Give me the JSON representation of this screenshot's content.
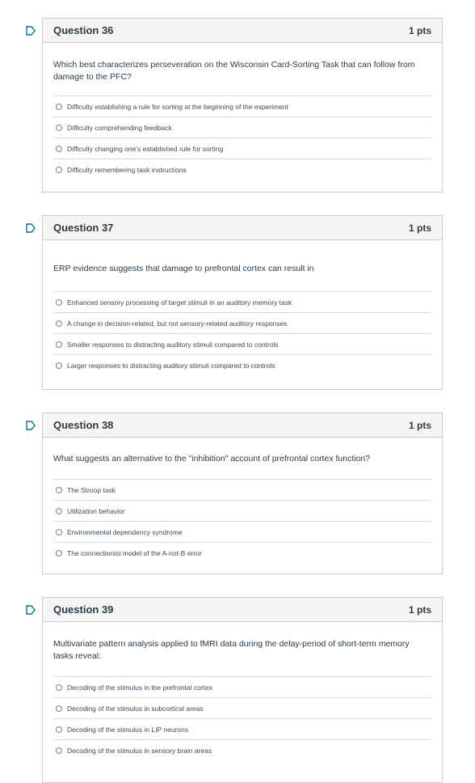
{
  "accent_color": "#0770a3",
  "questions": [
    {
      "title": "Question 36",
      "points": "1 pts",
      "text": "Which best characterizes perseveration on the Wisconsin Card-Sorting Task that can follow from damage to the PFC?",
      "answers": [
        "Difficulty establishing a rule for sorting at the beginning of the experiment",
        "Difficulty comprehending feedback",
        "Difficulty changing one's established rule for sorting",
        "Difficulty remembering task instructions"
      ]
    },
    {
      "title": "Question 37",
      "points": "1 pts",
      "text": "ERP evidence suggests that damage to prefrontal cortex can result in",
      "answers": [
        "Enhanced sensory processing of target stimuli in an auditory memory task",
        "A change in decision-related, but not sensory-related auditory responses",
        "Smaller responses to distracting auditory stimuli compared to controls",
        "Larger responses to distracting auditory stimuli compared to controls"
      ]
    },
    {
      "title": "Question 38",
      "points": "1 pts",
      "text": "What suggests an alternative to the \"inhibition\" account of prefrontal cortex function?",
      "answers": [
        "The Stroop task",
        "Utilization behavior",
        "Environmental dependency syndrome",
        "The connectionist model of the A-not-B error"
      ]
    },
    {
      "title": "Question 39",
      "points": "1 pts",
      "text": "Multivariate pattern analysis applied to fMRI data during the delay-period of short-term memory tasks reveal:",
      "answers": [
        "Decoding of the stimulus in the prefrontal cortex",
        "Decoding of the stimulus in subcortical areas",
        "Decoding of the stimulus in LIP neurons",
        "Decoding of the stimulus in sensory brain areas"
      ]
    }
  ]
}
